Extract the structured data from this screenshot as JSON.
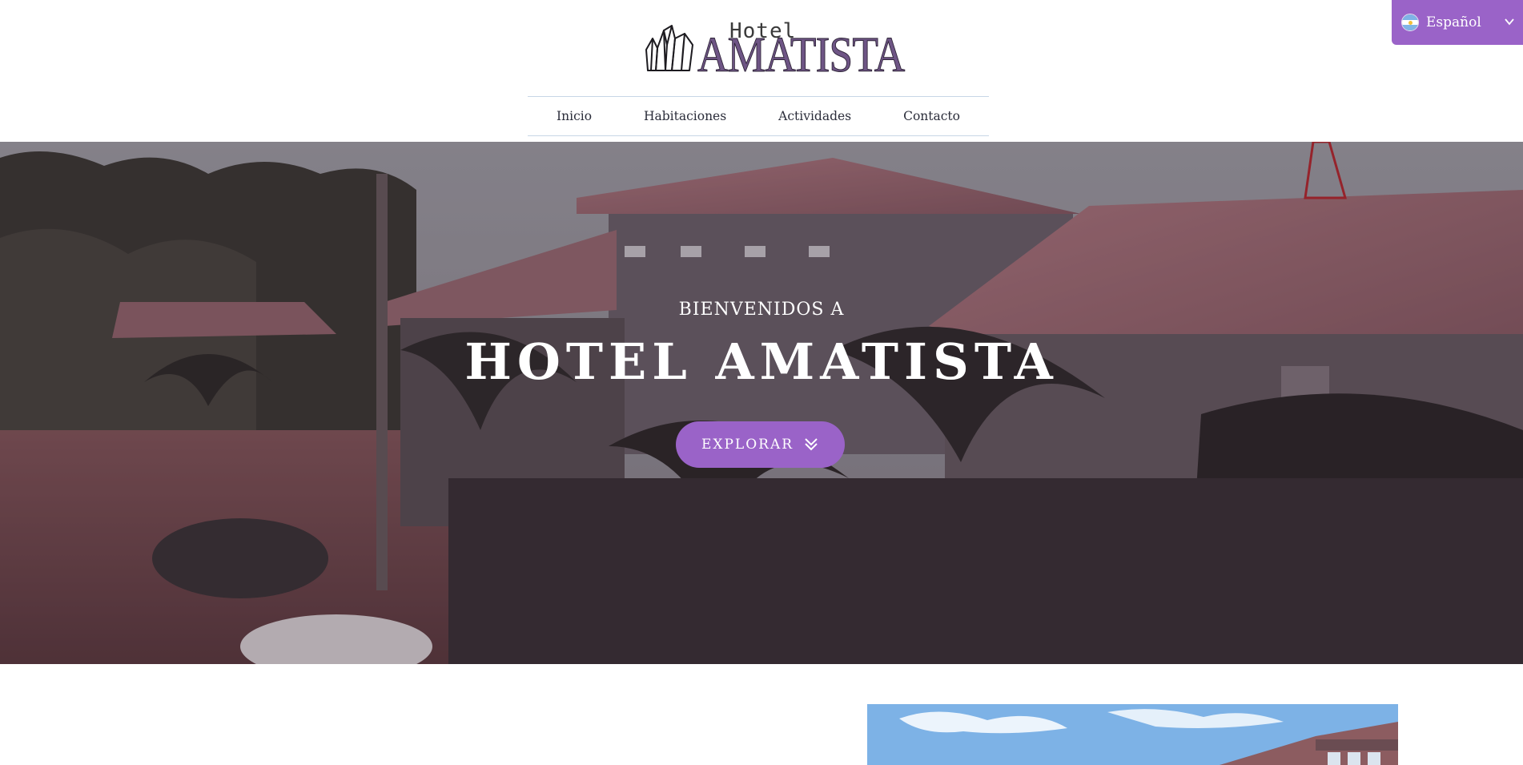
{
  "header": {
    "logo": {
      "hotel_word": "Hotel",
      "name": "AMATISTA",
      "icon": "amethyst-crystal-icon"
    },
    "nav": [
      {
        "label": "Inicio"
      },
      {
        "label": "Habitaciones"
      },
      {
        "label": "Actividades"
      },
      {
        "label": "Contacto"
      }
    ]
  },
  "language_selector": {
    "label": "Español",
    "flag_icon": "argentina-flag-icon",
    "chevron_icon": "chevron-down-icon"
  },
  "hero": {
    "subtitle": "BIENVENIDOS A",
    "title": "HOTEL AMATISTA",
    "button_label": "EXPLORAR",
    "button_icon": "double-chevron-down-icon"
  },
  "colors": {
    "accent": "#9a63c8",
    "logo_purple": "#6e5585",
    "nav_border": "#c7d6e6",
    "text_dark": "#2b2d3a"
  }
}
